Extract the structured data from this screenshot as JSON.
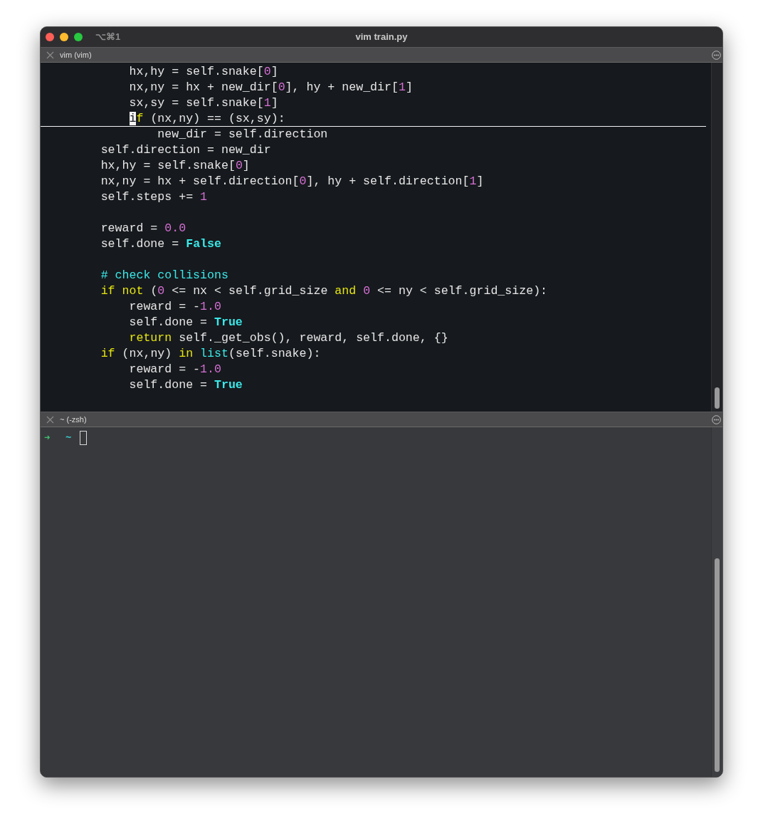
{
  "window": {
    "title": "vim train.py",
    "shortcut": "⌥⌘1"
  },
  "panes": [
    {
      "kind": "editor",
      "title": "vim (vim)",
      "lines": [
        {
          "cursorline": false,
          "segs": [
            {
              "kind": "plain",
              "t": "            hx,hy = self.snake["
            },
            {
              "kind": "number",
              "t": "0"
            },
            {
              "kind": "plain",
              "t": "]"
            }
          ]
        },
        {
          "cursorline": false,
          "segs": [
            {
              "kind": "plain",
              "t": "            nx,ny = hx + new_dir["
            },
            {
              "kind": "number",
              "t": "0"
            },
            {
              "kind": "plain",
              "t": "], hy + new_dir["
            },
            {
              "kind": "number",
              "t": "1"
            },
            {
              "kind": "plain",
              "t": "]"
            }
          ]
        },
        {
          "cursorline": false,
          "segs": [
            {
              "kind": "plain",
              "t": "            sx,sy = self.snake["
            },
            {
              "kind": "number",
              "t": "1"
            },
            {
              "kind": "plain",
              "t": "]"
            }
          ]
        },
        {
          "cursorline": true,
          "segs": [
            {
              "kind": "cursor",
              "t": "            i"
            },
            {
              "kind": "keyword",
              "t": "f"
            },
            {
              "kind": "plain",
              "t": " (nx,ny) == (sx,sy):"
            }
          ]
        },
        {
          "cursorline": false,
          "segs": [
            {
              "kind": "plain",
              "t": "                new_dir = self.direction"
            }
          ]
        },
        {
          "cursorline": false,
          "segs": [
            {
              "kind": "plain",
              "t": "        self.direction = new_dir"
            }
          ]
        },
        {
          "cursorline": false,
          "segs": [
            {
              "kind": "plain",
              "t": "        hx,hy = self.snake["
            },
            {
              "kind": "number",
              "t": "0"
            },
            {
              "kind": "plain",
              "t": "]"
            }
          ]
        },
        {
          "cursorline": false,
          "segs": [
            {
              "kind": "plain",
              "t": "        nx,ny = hx + self.direction["
            },
            {
              "kind": "number",
              "t": "0"
            },
            {
              "kind": "plain",
              "t": "], hy + self.direction["
            },
            {
              "kind": "number",
              "t": "1"
            },
            {
              "kind": "plain",
              "t": "]"
            }
          ]
        },
        {
          "cursorline": false,
          "segs": [
            {
              "kind": "plain",
              "t": "        self.steps += "
            },
            {
              "kind": "number",
              "t": "1"
            }
          ]
        },
        {
          "cursorline": false
        },
        {
          "cursorline": false,
          "segs": [
            {
              "kind": "plain",
              "t": "        reward = "
            },
            {
              "kind": "number",
              "t": "0.0"
            }
          ]
        },
        {
          "cursorline": false,
          "segs": [
            {
              "kind": "plain",
              "t": "        self.done = "
            },
            {
              "kind": "const",
              "t": "False"
            }
          ]
        },
        {
          "cursorline": false
        },
        {
          "cursorline": false,
          "segs": [
            {
              "kind": "comment",
              "t": "        # check collisions"
            }
          ]
        },
        {
          "cursorline": false,
          "segs": [
            {
              "kind": "keyword",
              "t": "        if not"
            },
            {
              "kind": "plain",
              "t": " ("
            },
            {
              "kind": "number",
              "t": "0"
            },
            {
              "kind": "plain",
              "t": " <= nx < self.grid_size "
            },
            {
              "kind": "keyword",
              "t": "and"
            },
            {
              "kind": "number",
              "t": " 0"
            },
            {
              "kind": "plain",
              "t": " <= ny < self.grid_size):"
            }
          ]
        },
        {
          "cursorline": false,
          "segs": [
            {
              "kind": "plain",
              "t": "            reward = -"
            },
            {
              "kind": "number",
              "t": "1.0"
            }
          ]
        },
        {
          "cursorline": false,
          "segs": [
            {
              "kind": "plain",
              "t": "            self.done = "
            },
            {
              "kind": "const",
              "t": "True"
            }
          ]
        },
        {
          "cursorline": false,
          "segs": [
            {
              "kind": "keyword",
              "t": "            return"
            },
            {
              "kind": "plain",
              "t": " self._get_obs(), reward, self.done, {}"
            }
          ]
        },
        {
          "cursorline": false,
          "segs": [
            {
              "kind": "keyword",
              "t": "        if"
            },
            {
              "kind": "plain",
              "t": " (nx,ny) "
            },
            {
              "kind": "keyword",
              "t": "in"
            },
            {
              "kind": "builtin",
              "t": " list"
            },
            {
              "kind": "plain",
              "t": "(self.snake):"
            }
          ]
        },
        {
          "cursorline": false,
          "segs": [
            {
              "kind": "plain",
              "t": "            reward = -"
            },
            {
              "kind": "number",
              "t": "1.0"
            }
          ]
        },
        {
          "cursorline": false,
          "segs": [
            {
              "kind": "plain",
              "t": "            self.done = "
            },
            {
              "kind": "const",
              "t": "True"
            }
          ]
        }
      ]
    },
    {
      "kind": "shell",
      "title": "~ (-zsh)",
      "prompt": {
        "arrow": "➜",
        "dir": "~"
      }
    }
  ]
}
